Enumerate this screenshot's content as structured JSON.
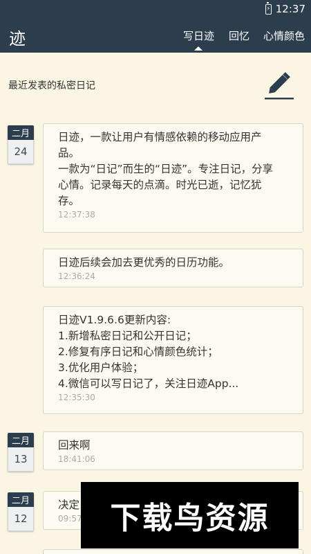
{
  "status_bar": {
    "time": "12:37",
    "battery_glyph": "⚡"
  },
  "app_bar": {
    "logo": "迹",
    "tabs": [
      {
        "label": "写日迹",
        "active": true
      },
      {
        "label": "回忆",
        "active": false
      },
      {
        "label": "心情颜色",
        "active": false
      }
    ]
  },
  "section_title": "最近发表的私密日记",
  "compose_icon": "pen-icon",
  "entries": [
    {
      "month": "二月",
      "day": "24",
      "text": "日迹，一款让用户有情感依赖的移动应用产\n品。\n一款为“日记”而生的“日迹”。专注日记，分享\n心情。记录每天的点滴。时光已逝，记忆犹\n存。",
      "time": "12:37:38"
    },
    {
      "text": "日迹后续会加去更优秀的日历功能。",
      "time": "12:36:24"
    },
    {
      "text": "日迹V1.9.6.6更新内容:\n1.新增私密日记和公开日记；\n2.修复有序日记和心情颜色统计；\n3.优化用户体验；\n4.微信可以写日记了，关注日迹App...",
      "time": "12:35:30"
    },
    {
      "month": "二月",
      "day": "13",
      "text": "回来啊",
      "time": "18:41:06"
    },
    {
      "month": "二月",
      "day": "12",
      "text": "决定",
      "time": "09:57"
    }
  ],
  "watermark": "下载鸟资源",
  "colors": {
    "primary": "#2c3e4e",
    "background": "#fbf6e3",
    "card": "#fdfbf1"
  }
}
